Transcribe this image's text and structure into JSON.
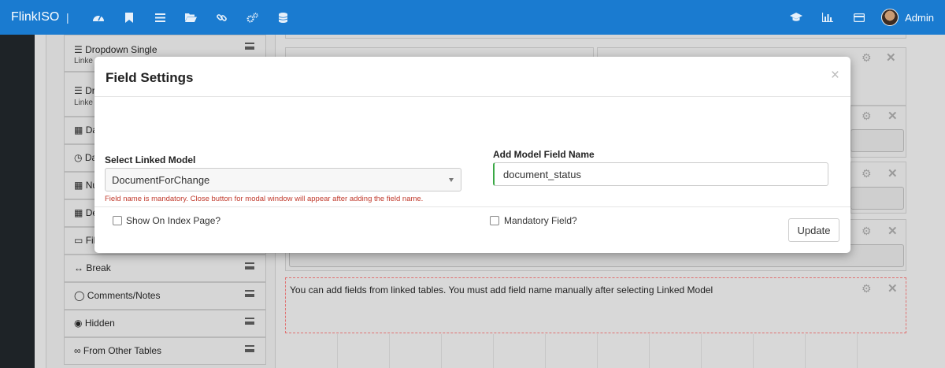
{
  "app": {
    "brand": "FlinkISO",
    "separator": "|",
    "user_name": "Admin"
  },
  "nav": {
    "left_icons": [
      "dashboard-icon",
      "bookmark-icon",
      "list-icon",
      "folder-open-icon",
      "link-icon",
      "cogs-icon",
      "database-icon"
    ],
    "right_icons": [
      "graduation-cap-icon",
      "bar-chart-icon",
      "credit-card-icon"
    ]
  },
  "field_types": [
    {
      "label": "Dropdown Single",
      "sub": "Linke",
      "icon": "list-icon"
    },
    {
      "label": "Dr",
      "sub": "Linke",
      "icon": "list-icon"
    },
    {
      "label": "Da",
      "icon": "calendar-icon"
    },
    {
      "label": "Da",
      "icon": "clock-icon"
    },
    {
      "label": "Nu",
      "icon": "calculator-icon"
    },
    {
      "label": "De",
      "icon": "calculator-icon"
    },
    {
      "label": "Fil",
      "icon": "file-icon"
    },
    {
      "label": "Break",
      "icon": "arrows-h-icon"
    },
    {
      "label": "Comments/Notes",
      "icon": "comment-icon"
    },
    {
      "label": "Hidden",
      "icon": "eye-slash-icon"
    },
    {
      "label": "From Other Tables",
      "icon": "link-icon"
    }
  ],
  "linked_note": "You can add fields from linked tables. You must add field name manually after selecting Linked Model",
  "modal": {
    "title": "Field Settings",
    "close_glyph": "×",
    "select_label": "Select Linked Model",
    "select_value": "DocumentForChange",
    "hint": "Field name is mandatory. Close button for modal window will appear after adding the field name.",
    "field_name_label": "Add Model Field Name",
    "field_name_value": "document_status",
    "show_on_index_label": "Show On Index Page?",
    "mandatory_label": "Mandatory Field?",
    "update_label": "Update"
  },
  "colors": {
    "topbar": "#1a7bd0",
    "focus_border": "#3aa845",
    "hint": "#c0392b"
  }
}
